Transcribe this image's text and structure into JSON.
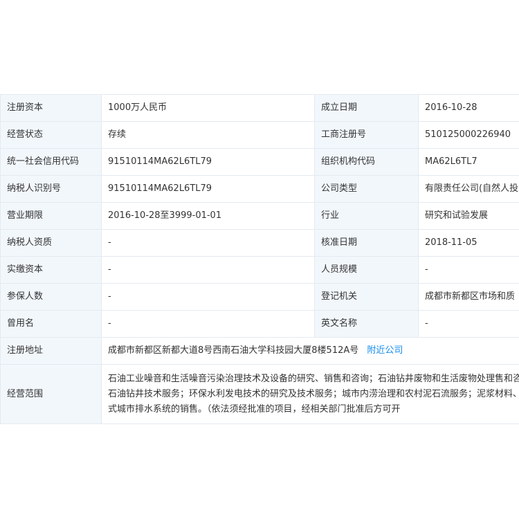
{
  "table": {
    "rows": [
      {
        "l1": "注册资本",
        "v1": "1000万人民币",
        "l2": "成立日期",
        "v2": "2016-10-28"
      },
      {
        "l1": "经营状态",
        "v1": "存续",
        "l2": "工商注册号",
        "v2": "510125000226940"
      },
      {
        "l1": "统一社会信用代码",
        "v1": "91510114MA62L6TL79",
        "l2": "组织机构代码",
        "v2": "MA62L6TL7"
      },
      {
        "l1": "纳税人识别号",
        "v1": "91510114MA62L6TL79",
        "l2": "公司类型",
        "v2": "有限责任公司(自然人投"
      },
      {
        "l1": "营业期限",
        "v1": "2016-10-28至3999-01-01",
        "l2": "行业",
        "v2": "研究和试验发展"
      },
      {
        "l1": "纳税人资质",
        "v1": "-",
        "l2": "核准日期",
        "v2": "2018-11-05"
      },
      {
        "l1": "实缴资本",
        "v1": "-",
        "l2": "人员规模",
        "v2": "-"
      },
      {
        "l1": "参保人数",
        "v1": "-",
        "l2": "登记机关",
        "v2": "成都市新都区市场和质"
      },
      {
        "l1": "曾用名",
        "v1": "-",
        "l2": "英文名称",
        "v2": "-"
      }
    ],
    "address": {
      "label": "注册地址",
      "value": "成都市新都区新都大道8号西南石油大学科技园大厦8楼512A号",
      "link": "附近公司"
    },
    "scope": {
      "label": "经营范围",
      "value": "石油工业噪音和生活噪音污染治理技术及设备的研究、销售和咨询；石油钻井废物和生活废物处理售和咨询；石油钻井技术服务；环保水利发电技术的研究及技术服务；城市内涝治理和农村泥石流服务；泥浆材料、反压式城市排水系统的销售。（依法须经批准的项目，经相关部门批准后方可开"
    }
  }
}
